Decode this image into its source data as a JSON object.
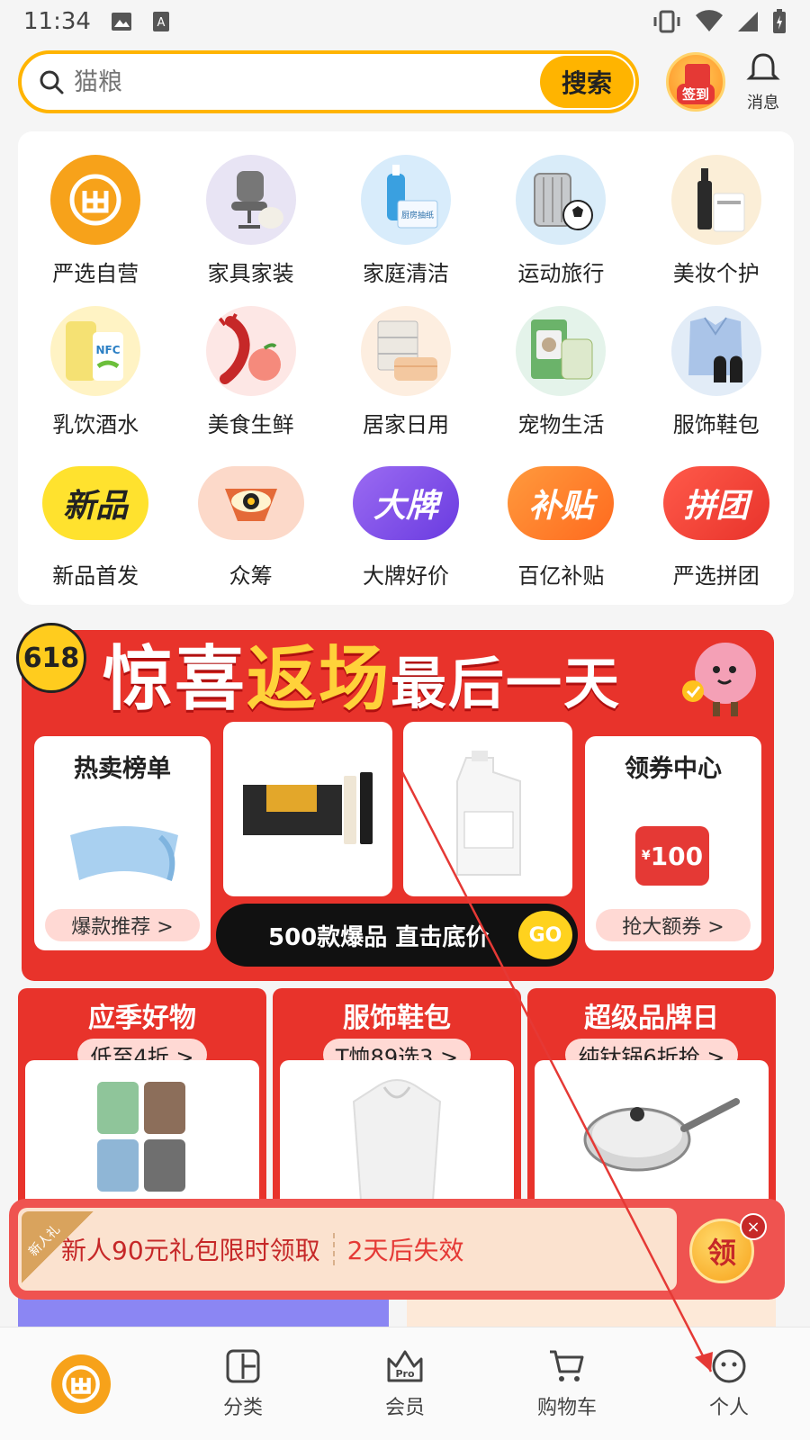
{
  "status_bar": {
    "time": "11:34",
    "icon_names": [
      "image-icon",
      "font-icon",
      "vibrate-icon",
      "wifi-icon",
      "signal-icon",
      "battery-icon"
    ]
  },
  "search": {
    "placeholder": "猫粮",
    "button_label": "搜索"
  },
  "header": {
    "signin_label": "签到",
    "message_label": "消息"
  },
  "categories": [
    {
      "label": "严选自营",
      "icon": "yanxuan-logo-icon"
    },
    {
      "label": "家具家装",
      "icon": "chair-icon"
    },
    {
      "label": "家庭清洁",
      "icon": "cleaning-bottle-icon",
      "badge": "厨房抽纸"
    },
    {
      "label": "运动旅行",
      "icon": "suitcase-ball-icon"
    },
    {
      "label": "美妆个护",
      "icon": "cosmetics-icon"
    },
    {
      "label": "乳饮酒水",
      "icon": "drink-icon",
      "badge": "NFC"
    },
    {
      "label": "美食生鲜",
      "icon": "lobster-peach-icon"
    },
    {
      "label": "居家日用",
      "icon": "drawer-towel-icon"
    },
    {
      "label": "宠物生活",
      "icon": "pet-food-icon"
    },
    {
      "label": "服饰鞋包",
      "icon": "shirt-shoes-icon"
    },
    {
      "label": "新品首发",
      "icon": "new-badge-icon",
      "badge": "新品"
    },
    {
      "label": "众筹",
      "icon": "eye-shield-icon"
    },
    {
      "label": "大牌好价",
      "icon": "big-brand-badge-icon",
      "badge": "大牌"
    },
    {
      "label": "百亿补贴",
      "icon": "subsidy-badge-icon",
      "badge": "补贴"
    },
    {
      "label": "严选拼团",
      "icon": "group-buy-badge-icon",
      "badge": "拼团"
    }
  ],
  "promo": {
    "badge": "618",
    "headline_pre": "惊喜",
    "headline_hl": "返场",
    "headline_post": "最后一天",
    "cards": [
      {
        "title": "热卖榜单",
        "pill": "爆款推荐 >",
        "icon": "blanket-icon"
      },
      {
        "title": "",
        "icon": "ginseng-gift-box-icon"
      },
      {
        "title": "",
        "icon": "detergent-bottle-icon"
      },
      {
        "title": "领券中心",
        "pill": "抢大额券 >",
        "icon": "coupon-icon",
        "coupon_value": "100",
        "currency": "¥"
      }
    ],
    "go_bar_text": "500款爆品 直击底价",
    "go_label": "GO"
  },
  "sub_banners": [
    {
      "title": "应季好物",
      "pill": "低至4折 >",
      "icon": "tea-canisters-icon"
    },
    {
      "title": "服饰鞋包",
      "pill": "T恤89选3 >",
      "icon": "white-hoodie-icon"
    },
    {
      "title": "超级品牌日",
      "pill": "纯钛锅6折抢 >",
      "icon": "frying-pan-icon"
    }
  ],
  "new_user_bar": {
    "ribbon": "新人礼",
    "text": "新人90元礼包限时领取",
    "expiry": "2天后失效",
    "claim_label": "领",
    "close_label": "×"
  },
  "tabbar": [
    {
      "label": "",
      "icon": "home-logo-icon"
    },
    {
      "label": "分类",
      "icon": "category-icon"
    },
    {
      "label": "会员",
      "icon": "pro-member-icon",
      "icon_text": "Pro"
    },
    {
      "label": "购物车",
      "icon": "cart-icon"
    },
    {
      "label": "个人",
      "icon": "profile-icon"
    }
  ],
  "colors": {
    "brand_yellow": "#ffb400",
    "promo_red": "#e8332b",
    "annotation_red": "#e53935"
  }
}
